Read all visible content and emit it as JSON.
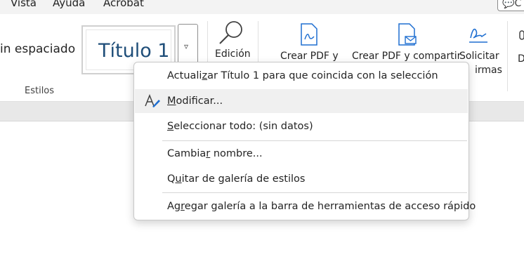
{
  "menubar": {
    "items": [
      "Vista",
      "Ayuda",
      "Acrobat"
    ],
    "comment_label": "C"
  },
  "ribbon": {
    "style_nospace": "in espaciado",
    "style_title": "Título 1",
    "group_styles_label": "Estilos",
    "edicion_label": "Edición",
    "tools": [
      {
        "label": "Crear PDF y",
        "icon": "pdf-create-icon"
      },
      {
        "label": "Crear PDF y compartir",
        "icon": "pdf-share-icon"
      },
      {
        "label": "Solicitar",
        "label2": "irmas",
        "icon": "signature-icon"
      },
      {
        "label": "D",
        "icon": "dictate-icon"
      }
    ],
    "gallery_more_glyph": "▿"
  },
  "context_menu": {
    "items": [
      {
        "pre": "Actuali",
        "ul": "z",
        "post": "ar Título 1 para que coincida con la selección"
      },
      {
        "pre": "",
        "ul": "M",
        "post": "odificar...",
        "icon": "modify-style-icon"
      },
      {
        "pre": "",
        "ul": "S",
        "post": "eleccionar todo: (sin datos)"
      },
      {
        "pre": "Cambia",
        "ul": "r",
        "post": " nombre..."
      },
      {
        "pre": "Q",
        "ul": "u",
        "post": "itar de galería de estilos"
      },
      {
        "pre": "Ag",
        "ul": "r",
        "post": "egar galería a la barra de herramientas de acceso rápido"
      }
    ]
  },
  "colors": {
    "title_style": "#1f4e79",
    "accent_blue": "#1f6fd1",
    "hover": "#f0f0f0"
  }
}
